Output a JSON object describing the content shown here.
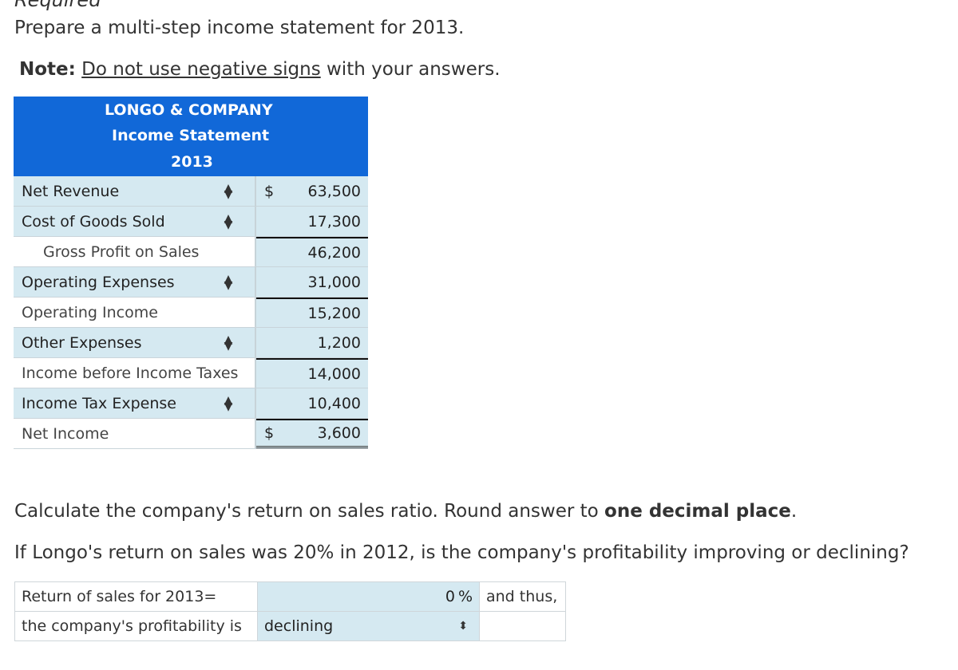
{
  "page": {
    "section_heading": "Required",
    "instruction": "Prepare a multi-step income statement for 2013.",
    "note_label": "Note:",
    "note_underlined": "Do not use negative signs",
    "note_rest": " with your answers."
  },
  "income_statement": {
    "company": "LONGO & COMPANY",
    "title": "Income Statement",
    "year": "2013",
    "header_color": "#1168d8",
    "input_color": "#d5e9f1",
    "rows": [
      {
        "label": "Net Revenue",
        "currency": "$",
        "value": "63,500",
        "dropdown": true
      },
      {
        "label": "Cost of Goods Sold",
        "currency": "",
        "value": "17,300",
        "dropdown": true
      },
      {
        "label": "Gross Profit on Sales",
        "currency": "",
        "value": "46,200",
        "dropdown": false
      },
      {
        "label": "Operating Expenses",
        "currency": "",
        "value": "31,000",
        "dropdown": true
      },
      {
        "label": "Operating Income",
        "currency": "",
        "value": "15,200",
        "dropdown": false
      },
      {
        "label": "Other Expenses",
        "currency": "",
        "value": "1,200",
        "dropdown": true
      },
      {
        "label": "Income before Income Taxes",
        "currency": "",
        "value": "14,000",
        "dropdown": false
      },
      {
        "label": "Income Tax Expense",
        "currency": "",
        "value": "10,400",
        "dropdown": true
      },
      {
        "label": "Net Income",
        "currency": "$",
        "value": "3,600",
        "dropdown": false
      }
    ]
  },
  "question": {
    "q1_text": "Calculate the company's return on sales ratio. Round answer to ",
    "q1_bold": "one decimal place",
    "q1_end": ".",
    "q2_text": "If Longo's return on sales was 20% in 2012, is the company's profitability improving or declining?"
  },
  "answer": {
    "row1_label": "Return of sales for 2013=",
    "row1_value": "0",
    "row1_unit": "%",
    "row1_suffix": "and thus,",
    "row2_label": "the company's profitability is",
    "row2_selected": "declining"
  }
}
